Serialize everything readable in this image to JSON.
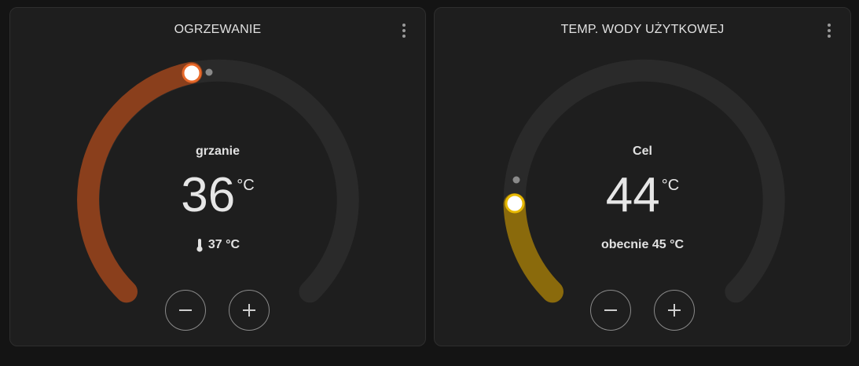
{
  "heating": {
    "title": "OGRZEWANIE",
    "mode": "grzanie",
    "target_value": "36",
    "unit": "°C",
    "current": "37 °C",
    "current_icon": "thermometer-icon",
    "fill_fraction": 0.37,
    "colors": {
      "arc": "#8a3f1c",
      "handle_ring": "#e8692a",
      "track": "#2a2a2a"
    }
  },
  "water": {
    "title": "TEMP. WODY UŻYTKOWEJ",
    "mode": "Cel",
    "target_value": "44",
    "unit": "°C",
    "current": "obecnie 45 °C",
    "fill_fraction": 0.16,
    "colors": {
      "arc": "#8a6a0c",
      "handle_ring": "#e6b800",
      "track": "#2a2a2a"
    }
  }
}
